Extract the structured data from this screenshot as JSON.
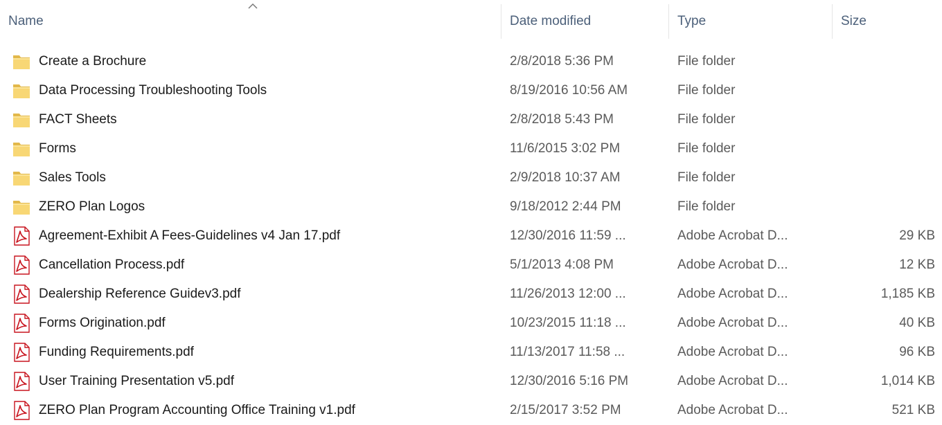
{
  "columns": {
    "name": "Name",
    "date": "Date modified",
    "type": "Type",
    "size": "Size"
  },
  "sort": {
    "column": "name",
    "direction": "ascending"
  },
  "colors": {
    "folder": "#f8d775",
    "folder_dark": "#e2b84a",
    "pdf": "#c8141e",
    "header_text": "#4c607a"
  },
  "files": [
    {
      "name": "Create a Brochure",
      "date": "2/8/2018 5:36 PM",
      "type": "File folder",
      "size": "",
      "icon": "folder-icon"
    },
    {
      "name": "Data Processing Troubleshooting Tools",
      "date": "8/19/2016 10:56 AM",
      "type": "File folder",
      "size": "",
      "icon": "folder-icon"
    },
    {
      "name": "FACT Sheets",
      "date": "2/8/2018 5:43 PM",
      "type": "File folder",
      "size": "",
      "icon": "folder-icon"
    },
    {
      "name": "Forms",
      "date": "11/6/2015 3:02 PM",
      "type": "File folder",
      "size": "",
      "icon": "folder-icon"
    },
    {
      "name": "Sales Tools",
      "date": "2/9/2018 10:37 AM",
      "type": "File folder",
      "size": "",
      "icon": "folder-icon"
    },
    {
      "name": "ZERO Plan Logos",
      "date": "9/18/2012 2:44 PM",
      "type": "File folder",
      "size": "",
      "icon": "folder-icon"
    },
    {
      "name": "Agreement-Exhibit A Fees-Guidelines v4 Jan 17.pdf",
      "date": "12/30/2016 11:59 ...",
      "type": "Adobe Acrobat D...",
      "size": "29 KB",
      "icon": "pdf-icon"
    },
    {
      "name": "Cancellation Process.pdf",
      "date": "5/1/2013 4:08 PM",
      "type": "Adobe Acrobat D...",
      "size": "12 KB",
      "icon": "pdf-icon"
    },
    {
      "name": "Dealership Reference Guidev3.pdf",
      "date": "11/26/2013 12:00 ...",
      "type": "Adobe Acrobat D...",
      "size": "1,185 KB",
      "icon": "pdf-icon"
    },
    {
      "name": "Forms Origination.pdf",
      "date": "10/23/2015 11:18 ...",
      "type": "Adobe Acrobat D...",
      "size": "40 KB",
      "icon": "pdf-icon"
    },
    {
      "name": "Funding Requirements.pdf",
      "date": "11/13/2017 11:58 ...",
      "type": "Adobe Acrobat D...",
      "size": "96 KB",
      "icon": "pdf-icon"
    },
    {
      "name": "User Training Presentation v5.pdf",
      "date": "12/30/2016 5:16 PM",
      "type": "Adobe Acrobat D...",
      "size": "1,014 KB",
      "icon": "pdf-icon"
    },
    {
      "name": "ZERO Plan Program Accounting Office Training v1.pdf",
      "date": "2/15/2017 3:52 PM",
      "type": "Adobe Acrobat D...",
      "size": "521 KB",
      "icon": "pdf-icon"
    }
  ]
}
